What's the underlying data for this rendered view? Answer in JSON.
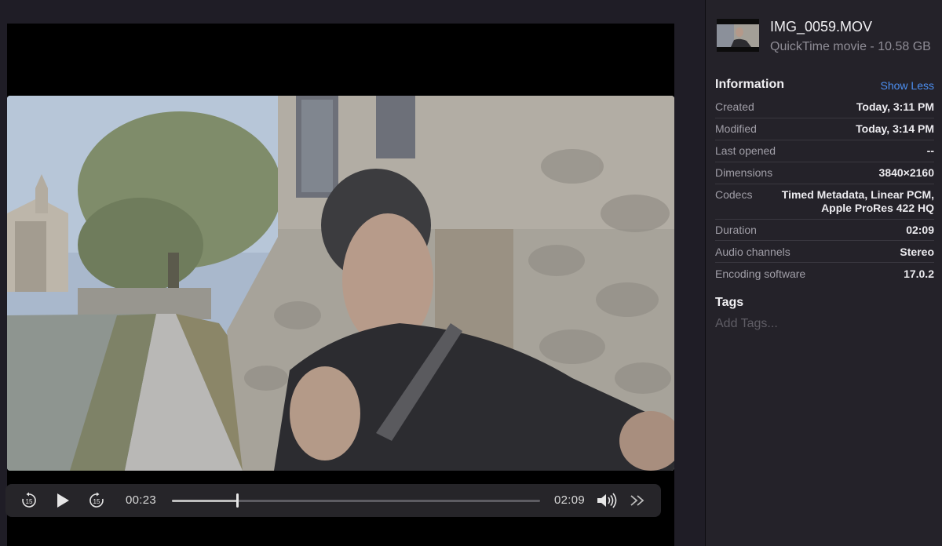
{
  "player": {
    "current_time": "00:23",
    "total_time": "02:09",
    "progress": 0.178,
    "skip_back_seconds": "15",
    "skip_forward_seconds": "15"
  },
  "inspector": {
    "file_name": "IMG_0059.MOV",
    "file_kind": "QuickTime movie - 10.58 GB",
    "information_title": "Information",
    "show_less_label": "Show Less",
    "rows": [
      {
        "label": "Created",
        "value": "Today, 3:11 PM"
      },
      {
        "label": "Modified",
        "value": "Today, 3:14 PM"
      },
      {
        "label": "Last opened",
        "value": "--"
      },
      {
        "label": "Dimensions",
        "value": "3840×2160"
      },
      {
        "label": "Codecs",
        "value": "Timed Metadata, Linear PCM,\nApple ProRes 422 HQ"
      },
      {
        "label": "Duration",
        "value": "02:09"
      },
      {
        "label": "Audio channels",
        "value": "Stereo"
      },
      {
        "label": "Encoding software",
        "value": "17.0.2"
      }
    ],
    "tags_title": "Tags",
    "add_tags_placeholder": "Add Tags..."
  },
  "colors": {
    "accent_link": "#4c8ff1",
    "panel_bg": "#242229",
    "controls_bg": "#262529"
  }
}
